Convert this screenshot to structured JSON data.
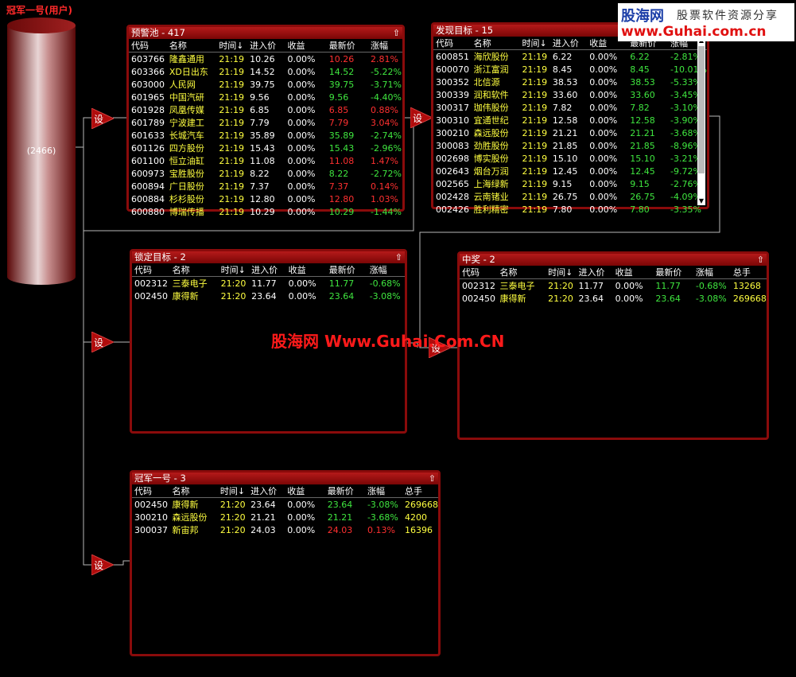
{
  "app_title": "冠军一号(用户)",
  "source": {
    "label": "(2466)"
  },
  "set_label": "设",
  "up_icon": "⇧",
  "watermark_text": "股海网 Www.Guhai.Com.CN",
  "logo": {
    "main": "股海网",
    "tagline": "股票软件资源分享",
    "url": "www.Guhai.com.cn"
  },
  "colors": {
    "up": "#ff3030",
    "down": "#3fe63f",
    "panel_border": "#8a0b0b"
  },
  "panels": {
    "p1": {
      "title": "预警池 - 417",
      "columns": [
        "代码",
        "名称",
        "时间↓",
        "进入价",
        "收益",
        "最新价",
        "涨幅"
      ],
      "rows": [
        [
          "603766",
          "隆鑫通用",
          "21:19",
          "10.26",
          "0.00%",
          "10.26",
          "2.81%"
        ],
        [
          "603366",
          "XD日出东",
          "21:19",
          "14.52",
          "0.00%",
          "14.52",
          "-5.22%"
        ],
        [
          "603000",
          "人民网",
          "21:19",
          "39.75",
          "0.00%",
          "39.75",
          "-3.71%"
        ],
        [
          "601965",
          "中国汽研",
          "21:19",
          "9.56",
          "0.00%",
          "9.56",
          "-4.40%"
        ],
        [
          "601928",
          "凤凰传媒",
          "21:19",
          "6.85",
          "0.00%",
          "6.85",
          "0.88%"
        ],
        [
          "601789",
          "宁波建工",
          "21:19",
          "7.79",
          "0.00%",
          "7.79",
          "3.04%"
        ],
        [
          "601633",
          "长城汽车",
          "21:19",
          "35.89",
          "0.00%",
          "35.89",
          "-2.74%"
        ],
        [
          "601126",
          "四方股份",
          "21:19",
          "15.43",
          "0.00%",
          "15.43",
          "-2.96%"
        ],
        [
          "601100",
          "恒立油缸",
          "21:19",
          "11.08",
          "0.00%",
          "11.08",
          "1.47%"
        ],
        [
          "600973",
          "宝胜股份",
          "21:19",
          "8.22",
          "0.00%",
          "8.22",
          "-2.72%"
        ],
        [
          "600894",
          "广日股份",
          "21:19",
          "7.37",
          "0.00%",
          "7.37",
          "0.14%"
        ],
        [
          "600884",
          "杉杉股份",
          "21:19",
          "12.80",
          "0.00%",
          "12.80",
          "1.03%"
        ],
        [
          "600880",
          "博瑞传播",
          "21:19",
          "10.29",
          "0.00%",
          "10.29",
          "-1.44%"
        ]
      ]
    },
    "p2": {
      "title": "发现目标 - 15",
      "columns": [
        "代码",
        "名称",
        "时间↓",
        "进入价",
        "收益",
        "最新价",
        "涨幅"
      ],
      "rows": [
        [
          "600851",
          "海欣股份",
          "21:19",
          "6.22",
          "0.00%",
          "6.22",
          "-2.81%"
        ],
        [
          "600070",
          "浙江富润",
          "21:19",
          "8.45",
          "0.00%",
          "8.45",
          "-10.01%"
        ],
        [
          "300352",
          "北信源",
          "21:19",
          "38.53",
          "0.00%",
          "38.53",
          "-5.33%"
        ],
        [
          "300339",
          "润和软件",
          "21:19",
          "33.60",
          "0.00%",
          "33.60",
          "-3.45%"
        ],
        [
          "300317",
          "珈伟股份",
          "21:19",
          "7.82",
          "0.00%",
          "7.82",
          "-3.10%"
        ],
        [
          "300310",
          "宜通世纪",
          "21:19",
          "12.58",
          "0.00%",
          "12.58",
          "-3.90%"
        ],
        [
          "300210",
          "森远股份",
          "21:19",
          "21.21",
          "0.00%",
          "21.21",
          "-3.68%"
        ],
        [
          "300083",
          "劲胜股份",
          "21:19",
          "21.85",
          "0.00%",
          "21.85",
          "-8.96%"
        ],
        [
          "002698",
          "博实股份",
          "21:19",
          "15.10",
          "0.00%",
          "15.10",
          "-3.21%"
        ],
        [
          "002643",
          "烟台万润",
          "21:19",
          "12.45",
          "0.00%",
          "12.45",
          "-9.72%"
        ],
        [
          "002565",
          "上海绿新",
          "21:19",
          "9.15",
          "0.00%",
          "9.15",
          "-2.76%"
        ],
        [
          "002428",
          "云南锗业",
          "21:19",
          "26.75",
          "0.00%",
          "26.75",
          "-4.09%"
        ],
        [
          "002426",
          "胜利精密",
          "21:19",
          "7.80",
          "0.00%",
          "7.80",
          "-3.35%"
        ]
      ]
    },
    "p3": {
      "title": "锁定目标 - 2",
      "columns": [
        "代码",
        "名称",
        "时间↓",
        "进入价",
        "收益",
        "最新价",
        "涨幅"
      ],
      "rows": [
        [
          "002312",
          "三泰电子",
          "21:20",
          "11.77",
          "0.00%",
          "11.77",
          "-0.68%"
        ],
        [
          "002450",
          "康得新",
          "21:20",
          "23.64",
          "0.00%",
          "23.64",
          "-3.08%"
        ]
      ]
    },
    "p4": {
      "title": "中奖 - 2",
      "columns": [
        "代码",
        "名称",
        "时间↓",
        "进入价",
        "收益",
        "最新价",
        "涨幅",
        "总手"
      ],
      "rows": [
        [
          "002312",
          "三泰电子",
          "21:20",
          "11.77",
          "0.00%",
          "11.77",
          "-0.68%",
          "13268"
        ],
        [
          "002450",
          "康得新",
          "21:20",
          "23.64",
          "0.00%",
          "23.64",
          "-3.08%",
          "269668"
        ]
      ]
    },
    "p5": {
      "title": "冠军一号 - 3",
      "columns": [
        "代码",
        "名称",
        "时间↓",
        "进入价",
        "收益",
        "最新价",
        "涨幅",
        "总手"
      ],
      "rows": [
        [
          "002450",
          "康得新",
          "21:20",
          "23.64",
          "0.00%",
          "23.64",
          "-3.08%",
          "269668"
        ],
        [
          "300210",
          "森远股份",
          "21:20",
          "21.21",
          "0.00%",
          "21.21",
          "-3.68%",
          "4200"
        ],
        [
          "300037",
          "新宙邦",
          "21:20",
          "24.03",
          "0.00%",
          "24.03",
          "0.13%",
          "16396"
        ]
      ]
    }
  }
}
